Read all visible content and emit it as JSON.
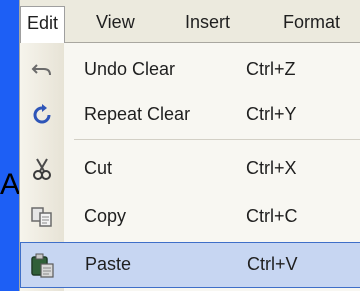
{
  "left_glyph": "A",
  "menubar": {
    "items": [
      {
        "label": "Edit",
        "mnemonic_underline": "E"
      },
      {
        "label": "View"
      },
      {
        "label": "Insert"
      },
      {
        "label": "Format"
      }
    ]
  },
  "edit_menu": {
    "items": [
      {
        "label": "Undo Clear",
        "shortcut": "Ctrl+Z",
        "icon": "undo-icon"
      },
      {
        "label": "Repeat Clear",
        "shortcut": "Ctrl+Y",
        "icon": "repeat-icon"
      },
      {
        "label": "Cut",
        "shortcut": "Ctrl+X",
        "icon": "scissors-icon"
      },
      {
        "label": "Copy",
        "shortcut": "Ctrl+C",
        "icon": "copy-icon"
      },
      {
        "label": "Paste",
        "shortcut": "Ctrl+V",
        "icon": "paste-icon",
        "highlighted": true
      }
    ]
  },
  "colors": {
    "background": "#1d5ff5",
    "highlight": "#c7d6f2",
    "highlight_border": "#3f6fc8"
  }
}
